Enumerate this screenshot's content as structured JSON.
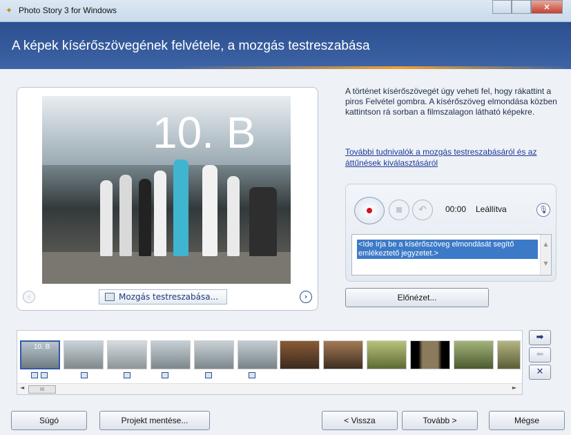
{
  "window": {
    "title": "Photo Story 3 for Windows",
    "close_glyph": "×"
  },
  "header": {
    "title": "A képek kísérőszövegének felvétele, a mozgás testreszabása"
  },
  "preview": {
    "photo_caption": "10. B",
    "motion_button": "Mozgás testreszabása...",
    "prev_glyph": "‹",
    "next_glyph": "›"
  },
  "sidebar": {
    "description": "A történet kísérőszövegét úgy veheti fel, hogy rákattint a piros Felvétel gombra. A kísérőszöveg elmondása közben kattintson rá sorban a filmszalagon látható képekre.",
    "more_link": "További tudnivalók a mozgás testreszabásáról és az áttűnések kiválasztásáról",
    "recorder": {
      "time": "00:00",
      "status": "Leállítva",
      "undo_glyph": "↶",
      "mic_glyph": "🎙"
    },
    "notes_text": "<Ide írja be a kísérőszöveg elmondását segítő emlékeztető jegyzetet.>",
    "preview_button": "Előnézet..."
  },
  "filmstrip": {
    "first_thumb_label": "10. B",
    "scroll_thumb": "III",
    "left_arrow": "◄",
    "right_arrow": "►",
    "up_arrow": "▲",
    "down_arrow": "▼"
  },
  "side_buttons": {
    "move_right": "➡",
    "move_left": "⬅",
    "remove": "✕"
  },
  "buttons": {
    "help": "Súgó",
    "save_project": "Projekt mentése...",
    "back": "< Vissza",
    "next": "Tovább >",
    "cancel": "Mégse"
  }
}
